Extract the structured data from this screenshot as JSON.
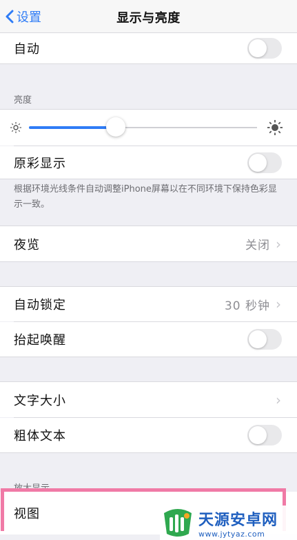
{
  "nav": {
    "back_label": "设置",
    "title": "显示与亮度"
  },
  "auto_row": {
    "label": "自动",
    "on": false
  },
  "brightness": {
    "section_label": "亮度",
    "level": 0.38
  },
  "true_tone": {
    "label": "原彩显示",
    "on": false,
    "footnote": "根据环境光线条件自动调整iPhone屏幕以在不同环境下保持色彩显示一致。"
  },
  "night_shift": {
    "label": "夜览",
    "value": "关闭"
  },
  "auto_lock": {
    "label": "自动锁定",
    "value": "30 秒钟"
  },
  "raise_to_wake": {
    "label": "抬起唤醒",
    "on": false
  },
  "text_size": {
    "label": "文字大小"
  },
  "bold_text": {
    "label": "粗体文本",
    "on": false
  },
  "zoom": {
    "section_label": "放大显示",
    "view_label": "视图"
  },
  "watermark": {
    "title": "天源安卓网",
    "url": "www.jytyaz.com"
  },
  "colors": {
    "accent": "#2f7cf6",
    "highlight_border": "#f07aa6"
  }
}
